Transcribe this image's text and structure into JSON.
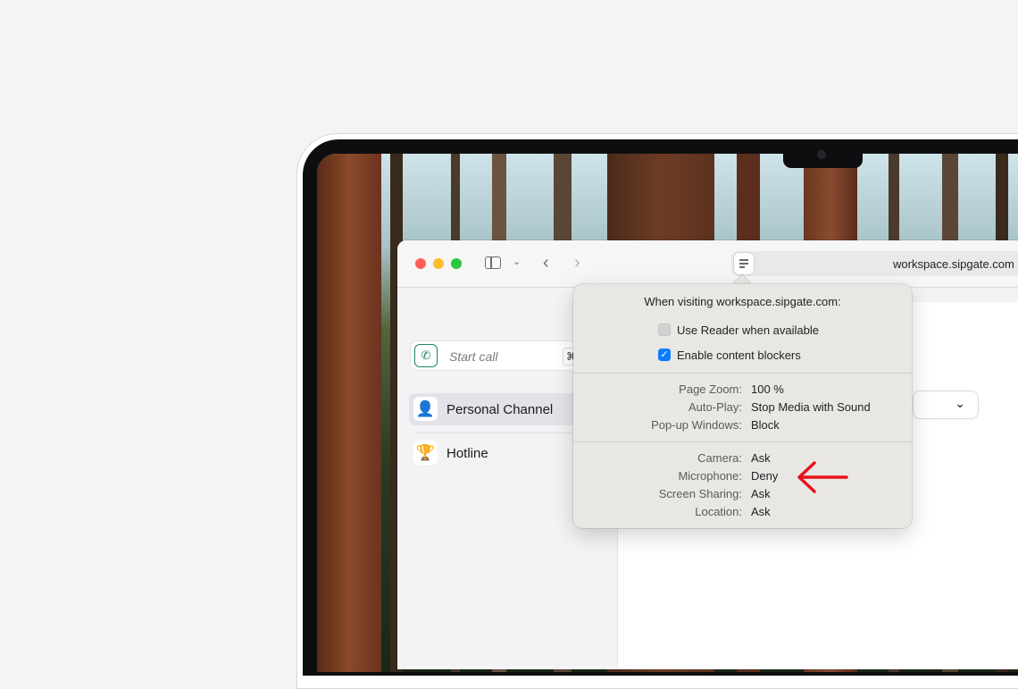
{
  "browser": {
    "url": "workspace.sipgate.com"
  },
  "sidebar": {
    "start_call_placeholder": "Start call",
    "shortcut_key": "⌘",
    "channels": [
      {
        "label": "Personal Channel",
        "icon": "person-silhouette-icon",
        "active": true
      },
      {
        "label": "Hotline",
        "icon": "trophy-icon",
        "active": false
      }
    ]
  },
  "popover": {
    "title": "When visiting workspace.sipgate.com:",
    "checkboxes": [
      {
        "label": "Use Reader when available",
        "checked": false
      },
      {
        "label": "Enable content blockers",
        "checked": true
      }
    ],
    "page_settings": [
      {
        "key": "Page Zoom:",
        "value": "100 %"
      },
      {
        "key": "Auto-Play:",
        "value": "Stop Media with Sound"
      },
      {
        "key": "Pop-up Windows:",
        "value": "Block"
      }
    ],
    "permissions": [
      {
        "key": "Camera:",
        "value": "Ask"
      },
      {
        "key": "Microphone:",
        "value": "Deny"
      },
      {
        "key": "Screen Sharing:",
        "value": "Ask"
      },
      {
        "key": "Location:",
        "value": "Ask"
      }
    ]
  },
  "colors": {
    "accent_blue": "#0a7cff",
    "annotation_red": "#e8131a",
    "phone_green": "#1f8a5c"
  }
}
